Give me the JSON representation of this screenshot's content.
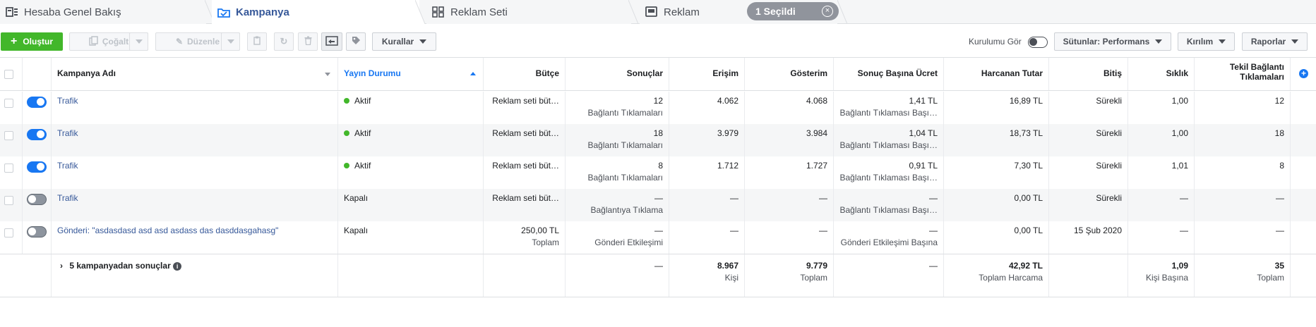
{
  "tabs": [
    {
      "label": "Hesaba Genel Bakış",
      "icon": "overview-icon"
    },
    {
      "label": "Kampanya",
      "icon": "campaign-folder-icon"
    },
    {
      "label": "Reklam Seti",
      "icon": "ad-set-grid-icon"
    },
    {
      "label": "Reklam",
      "icon": "ad-icon"
    }
  ],
  "selection": {
    "label": "1 Seçildi"
  },
  "toolbar": {
    "create_label": "Oluştur",
    "duplicate_label": "Çoğalt",
    "edit_label": "Düzenle",
    "rules_label": "Kurallar",
    "view_setup_label": "Kurulumu Gör",
    "columns_label": "Sütunlar: Performans",
    "breakdown_label": "Kırılım",
    "reports_label": "Raporlar"
  },
  "colors": {
    "accent": "#1877f2",
    "link": "#365899",
    "create": "#42b72a",
    "active_dot": "#42b72a"
  },
  "table": {
    "headers": {
      "name": "Kampanya Adı",
      "delivery": "Yayın Durumu",
      "budget": "Bütçe",
      "results": "Sonuçlar",
      "reach": "Erişim",
      "impressions": "Gösterim",
      "cost_per_result": "Sonuç Başına Ücret",
      "amount_spent": "Harcanan Tutar",
      "ends": "Bitiş",
      "frequency": "Sıklık",
      "unique_clicks": "Tekil Bağlantı Tıklamaları"
    },
    "rows": [
      {
        "on": true,
        "name": "Trafik",
        "delivery": "Aktif",
        "active": true,
        "budget": "Reklam seti büt…",
        "budget_sub": "",
        "results": "12",
        "results_sub": "Bağlantı Tıklamaları",
        "reach": "4.062",
        "impressions": "4.068",
        "cpr": "1,41 TL",
        "cpr_sub": "Bağlantı Tıklaması Başı…",
        "spent": "16,89 TL",
        "ends": "Sürekli",
        "freq": "1,00",
        "unique": "12"
      },
      {
        "on": true,
        "name": "Trafik",
        "delivery": "Aktif",
        "active": true,
        "budget": "Reklam seti büt…",
        "budget_sub": "",
        "results": "18",
        "results_sub": "Bağlantı Tıklamaları",
        "reach": "3.979",
        "impressions": "3.984",
        "cpr": "1,04 TL",
        "cpr_sub": "Bağlantı Tıklaması Başı…",
        "spent": "18,73 TL",
        "ends": "Sürekli",
        "freq": "1,00",
        "unique": "18"
      },
      {
        "on": true,
        "name": "Trafik",
        "delivery": "Aktif",
        "active": true,
        "budget": "Reklam seti büt…",
        "budget_sub": "",
        "results": "8",
        "results_sub": "Bağlantı Tıklamaları",
        "reach": "1.712",
        "impressions": "1.727",
        "cpr": "0,91 TL",
        "cpr_sub": "Bağlantı Tıklaması Başı…",
        "spent": "7,30 TL",
        "ends": "Sürekli",
        "freq": "1,01",
        "unique": "8"
      },
      {
        "on": false,
        "name": "Trafik",
        "delivery": "Kapalı",
        "active": false,
        "budget": "Reklam seti büt…",
        "budget_sub": "",
        "results": "—",
        "results_sub": "Bağlantıya Tıklama",
        "reach": "—",
        "impressions": "—",
        "cpr": "—",
        "cpr_sub": "Bağlantı Tıklaması Başı…",
        "spent": "0,00 TL",
        "ends": "Sürekli",
        "freq": "—",
        "unique": "—"
      },
      {
        "on": false,
        "name": "Gönderi: \"asdasdasd asd asd asdass das dasddasgahasg\"",
        "delivery": "Kapalı",
        "active": false,
        "budget": "250,00 TL",
        "budget_sub": "Toplam",
        "results": "—",
        "results_sub": "Gönderi Etkileşimi",
        "reach": "—",
        "impressions": "—",
        "cpr": "—",
        "cpr_sub": "Gönderi Etkileşimi Başına",
        "spent": "0,00 TL",
        "ends": "15 Şub 2020",
        "freq": "—",
        "unique": "—"
      }
    ],
    "summary": {
      "label": "5 kampanyadan sonuçlar",
      "results": "—",
      "reach": "8.967",
      "reach_sub": "Kişi",
      "impressions": "9.779",
      "impressions_sub": "Toplam",
      "cpr": "—",
      "spent": "42,92 TL",
      "spent_sub": "Toplam Harcama",
      "freq": "1,09",
      "freq_sub": "Kişi Başına",
      "unique": "35",
      "unique_sub": "Toplam"
    }
  }
}
